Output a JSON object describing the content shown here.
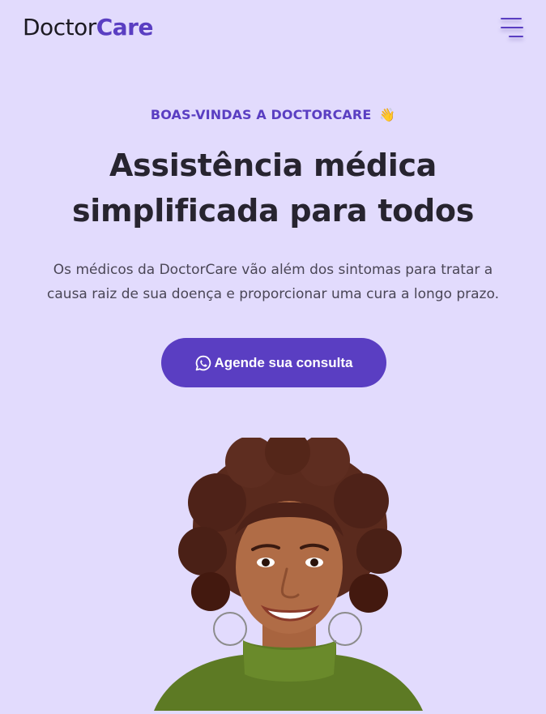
{
  "header": {
    "logo_primary": "Doctor",
    "logo_accent": "Care",
    "menu_icon": "hamburger-menu-icon"
  },
  "hero": {
    "welcome": "BOAS-VINDAS A DOCTORCARE",
    "welcome_emoji": "👋",
    "title_line1": "Assistência médica",
    "title_line2": "simplificada para todos",
    "subtitle_line1": "Os médicos da DoctorCare vão além dos sintomas para tratar a",
    "subtitle_line2": "causa raiz de sua doença e proporcionar uma cura a longo prazo.",
    "cta_label": "Agende sua consulta",
    "cta_icon": "whatsapp-icon",
    "image": "woman-smiling-portrait"
  },
  "colors": {
    "background": "#e2dbfd",
    "accent": "#5a3ec2",
    "heading": "#27242f",
    "body_text": "#4a4656"
  }
}
